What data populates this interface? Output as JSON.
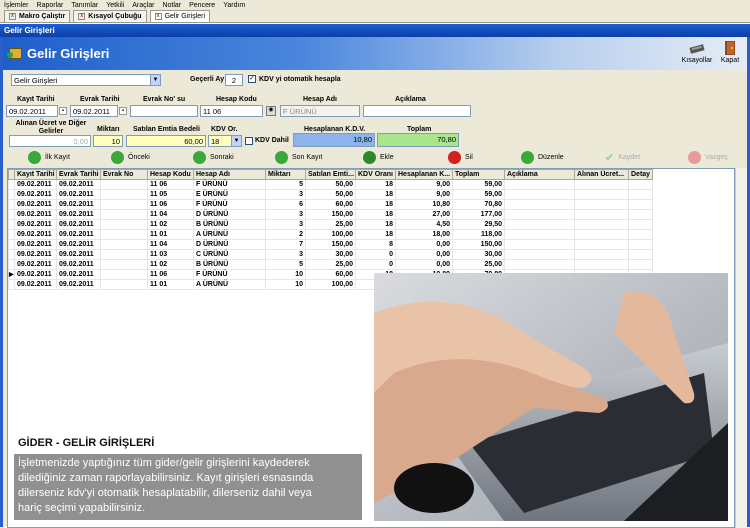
{
  "menubar": [
    "İşlemler",
    "Raporlar",
    "Tanımlar",
    "Yetkili",
    "Araçlar",
    "Notlar",
    "Pencere",
    "Yardım"
  ],
  "tabs": [
    {
      "label": "Makro Çalıştır",
      "active": false
    },
    {
      "label": "Kısayol Çubuğu",
      "active": false
    },
    {
      "label": "Gelir Girişleri",
      "active": true
    }
  ],
  "window_title": "Gelir Girişleri",
  "banner": {
    "title": "Gelir Girişleri",
    "shortcuts_label": "Kısayollar",
    "close_label": "Kapat"
  },
  "filters": {
    "type_value": "Gelir Girişleri",
    "past_months_label": "Geçerli Ay",
    "past_months_value": "2",
    "auto_vat_label": "KDV yi otomatik hesapla",
    "auto_vat_checked": true
  },
  "form": {
    "kayit_tarihi_label": "Kayıt Tarihi",
    "kayit_tarihi": "09.02.2011",
    "evrak_tarihi_label": "Evrak Tarihi",
    "evrak_tarihi": "09.02.2011",
    "evrak_no_label": "Evrak No' su",
    "evrak_no": "",
    "hesap_kodu_label": "Hesap Kodu",
    "hesap_kodu": "11 06",
    "hesap_adi_label": "Hesap Adı",
    "hesap_adi": "F ÜRÜNÜ",
    "aciklama_label": "Açıklama",
    "aciklama": "",
    "alinan_label": "Alınan Ücret ve Diğer Gelirler",
    "alinan": "0,00",
    "miktar_label": "Miktarı",
    "miktar": "10",
    "emtia_label": "Satılan Emtia Bedeli",
    "emtia": "60,00",
    "kdv_oran_label": "KDV Or.",
    "kdv_oran": "18",
    "kdv_dahil_label": "KDV Dahil",
    "hesaplanan_kdv_label": "Hesaplanan K.D.V.",
    "hesaplanan_kdv": "10,80",
    "toplam_label": "Toplam",
    "toplam": "70,80"
  },
  "nav": {
    "first": "İlk Kayıt",
    "prev": "Önceki",
    "next": "Sonraki",
    "last": "Son Kayıt",
    "add": "Ekle",
    "delete": "Sil",
    "edit": "Düzenle",
    "save": "Kaydet",
    "cancel": "Vazgeç"
  },
  "grid": {
    "columns": [
      "Kayıt Tarihi",
      "Evrak Tarihi",
      "Evrak No",
      "Hesap Kodu",
      "Hesap Adı",
      "Miktarı",
      "Satılan Emti...",
      "KDV Oranı",
      "Hesaplanan K...",
      "Toplam",
      "Açıklama",
      "Alınan Ücret...",
      "Detay"
    ],
    "rows": [
      [
        "09.02.2011",
        "09.02.2011",
        "",
        "11 06",
        "F ÜRÜNÜ",
        "5",
        "50,00",
        "18",
        "9,00",
        "59,00",
        "",
        "",
        ""
      ],
      [
        "09.02.2011",
        "09.02.2011",
        "",
        "11 05",
        "E ÜRÜNÜ",
        "3",
        "50,00",
        "18",
        "9,00",
        "59,00",
        "",
        "",
        ""
      ],
      [
        "09.02.2011",
        "09.02.2011",
        "",
        "11 06",
        "F ÜRÜNÜ",
        "6",
        "60,00",
        "18",
        "10,80",
        "70,80",
        "",
        "",
        ""
      ],
      [
        "09.02.2011",
        "09.02.2011",
        "",
        "11 04",
        "D ÜRÜNÜ",
        "3",
        "150,00",
        "18",
        "27,00",
        "177,00",
        "",
        "",
        ""
      ],
      [
        "09.02.2011",
        "09.02.2011",
        "",
        "11 02",
        "B ÜRÜNÜ",
        "3",
        "25,00",
        "18",
        "4,50",
        "29,50",
        "",
        "",
        ""
      ],
      [
        "09.02.2011",
        "09.02.2011",
        "",
        "11 01",
        "A ÜRÜNÜ",
        "2",
        "100,00",
        "18",
        "18,00",
        "118,00",
        "",
        "",
        ""
      ],
      [
        "09.02.2011",
        "09.02.2011",
        "",
        "11 04",
        "D ÜRÜNÜ",
        "7",
        "150,00",
        "8",
        "0,00",
        "150,00",
        "",
        "",
        ""
      ],
      [
        "09.02.2011",
        "09.02.2011",
        "",
        "11 03",
        "C ÜRÜNÜ",
        "3",
        "30,00",
        "0",
        "0,00",
        "30,00",
        "",
        "",
        ""
      ],
      [
        "09.02.2011",
        "09.02.2011",
        "",
        "11 02",
        "B ÜRÜNÜ",
        "5",
        "25,00",
        "0",
        "0,00",
        "25,00",
        "",
        "",
        ""
      ],
      [
        "09.02.2011",
        "09.02.2011",
        "",
        "11 06",
        "F ÜRÜNÜ",
        "10",
        "60,00",
        "18",
        "10,80",
        "70,80",
        "",
        "",
        ""
      ],
      [
        "09.02.2011",
        "09.02.2011",
        "",
        "11 01",
        "A ÜRÜNÜ",
        "10",
        "100,00",
        "0",
        "0,00",
        "100,00",
        "",
        "",
        ""
      ]
    ],
    "current_row": 9
  },
  "caption": {
    "title": "GİDER - GELİR GİRİŞLERİ",
    "line1": "İşletmenizde yaptığınız tüm gider/gelir girişlerini kaydederek",
    "line2": "dilediğiniz zaman raporlayabilirsiniz. Kayıt girişleri esnasında",
    "line3": "dilerseniz kdv'yi otomatik hesaplatabilir, dilerseniz dahil veya",
    "line4": "hariç seçimi yapabilirsiniz."
  }
}
